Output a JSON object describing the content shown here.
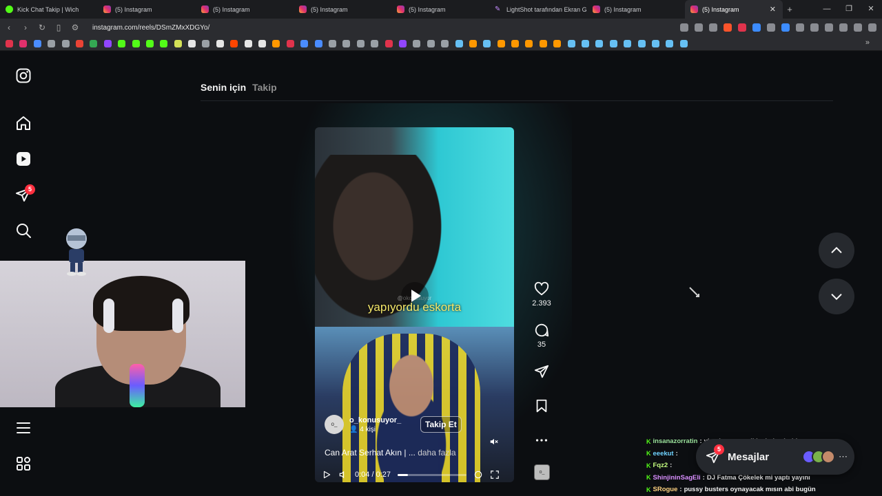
{
  "browser": {
    "tabs": [
      {
        "title": "Kick Chat Takip | Wich",
        "icon": "kick",
        "active": false
      },
      {
        "title": "(5) Instagram",
        "icon": "instagram",
        "active": false
      },
      {
        "title": "(5) Instagram",
        "icon": "instagram",
        "active": false
      },
      {
        "title": "(5) Instagram",
        "icon": "instagram",
        "active": false
      },
      {
        "title": "(5) Instagram",
        "icon": "instagram",
        "active": false
      },
      {
        "title": "LightShot tarafından Ekran Gö",
        "icon": "lightshot",
        "active": false
      },
      {
        "title": "(5) Instagram",
        "icon": "instagram",
        "active": false
      },
      {
        "title": "(5) Instagram",
        "icon": "instagram",
        "active": true
      }
    ],
    "url": "instagram.com/reels/DSmZMxXDGYo/",
    "bookmark_colors": [
      "#e0334c",
      "#e1306c",
      "#4a8cff",
      "#9aa0a6",
      "#9aa0a6",
      "#ea4335",
      "#34a853",
      "#9146ff",
      "#53fc18",
      "#53fc18",
      "#53fc18",
      "#53fc18",
      "#d4e157",
      "#e6e6e6",
      "#9aa0a6",
      "#e6e6e6",
      "#ff4500",
      "#e6e6e6",
      "#e6e6e6",
      "#ff9800",
      "#e0334c",
      "#4a8cff",
      "#4a8cff",
      "#9aa0a6",
      "#9aa0a6",
      "#9aa0a6",
      "#9aa0a6",
      "#e0334c",
      "#9146ff",
      "#9aa0a6",
      "#9aa0a6",
      "#9aa0a6",
      "#66c0f4",
      "#ff9800",
      "#66c0f4",
      "#ff9800",
      "#ff9800",
      "#ff9800",
      "#ff9800",
      "#ff9800",
      "#66c0f4",
      "#66c0f4",
      "#66c0f4",
      "#66c0f4",
      "#66c0f4",
      "#66c0f4",
      "#66c0f4",
      "#66c0f4",
      "#66c0f4"
    ]
  },
  "sidebar": {
    "items": [
      "instagram-logo",
      "home",
      "reels",
      "direct",
      "search",
      "more",
      "also-from-meta"
    ],
    "notification_count": "5"
  },
  "feed": {
    "tab_for_you": "Senin için",
    "tab_following": "Takip"
  },
  "reel": {
    "caption": "yapıyordu eskorta",
    "watermark": "@okonusuyor",
    "author": "o_konusuyor_",
    "author_avatar_text": "o_",
    "audience": "4 kişi",
    "follow_label": "Takip Et",
    "description": "Can Arat Serhat Akın | ...",
    "more_label": "daha fazla",
    "time": "0:04 / 0:27",
    "progress": 0.148,
    "likes": "2.393",
    "comments": "35"
  },
  "chat": [
    {
      "user": "insanazorratin",
      "text": "yine karamızı sikicek dışı buldu",
      "color": "u1"
    },
    {
      "user": "eeekut",
      "text": "",
      "color": "u2"
    },
    {
      "user": "Fqz2",
      "text": "",
      "color": "u3"
    },
    {
      "user": "ShinjininSagEli",
      "text": "DJ Fatma Çökelek mi yaptı yayını",
      "color": "u4"
    },
    {
      "user": "SRogue",
      "text": "pussy busters oynayacak mısın abi bugün",
      "color": "u5"
    }
  ],
  "messages": {
    "label": "Mesajlar",
    "count": "5"
  },
  "colors": {
    "accent_badge": "#ff3040",
    "kick_green": "#53fc18"
  }
}
